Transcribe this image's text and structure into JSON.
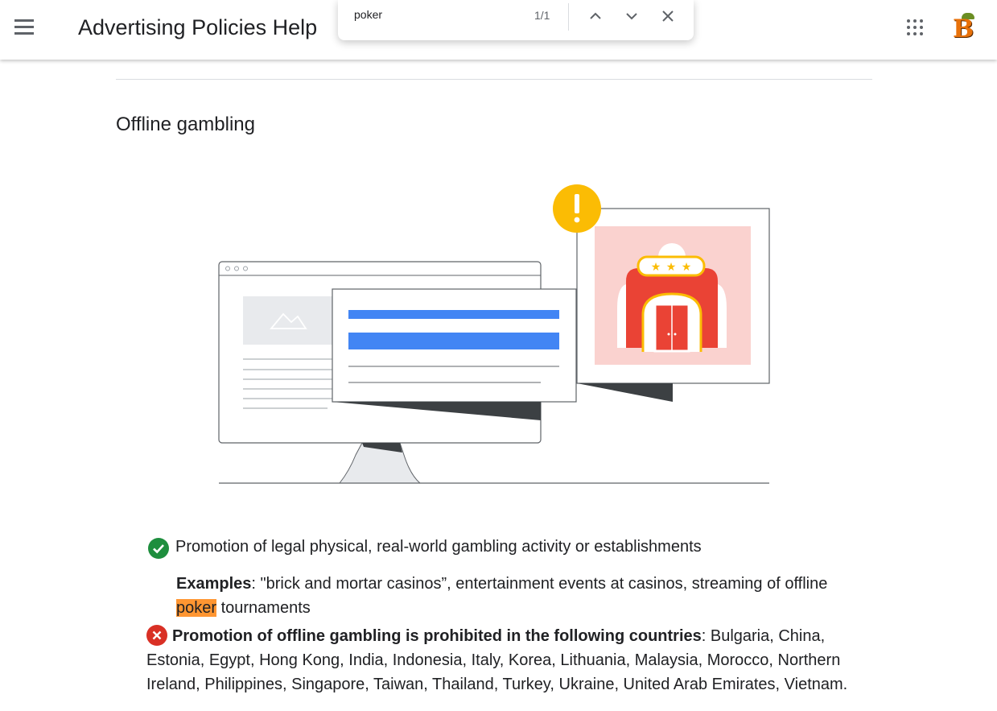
{
  "header": {
    "title": "Advertising Policies Help",
    "menu_icon": "hamburger-menu-icon",
    "apps_icon": "apps-grid-icon",
    "avatar_letter": "B"
  },
  "find_bar": {
    "query": "poker",
    "count": "1/1",
    "prev_icon": "chevron-up-icon",
    "next_icon": "chevron-down-icon",
    "close_icon": "close-icon"
  },
  "section": {
    "heading": "Offline gambling"
  },
  "allowed": {
    "icon": "check-circle-icon",
    "color": "#1e8e3e",
    "text": "Promotion of legal physical, real-world gambling activity or establishments",
    "examples_label": "Examples",
    "examples_text_before": ": \"brick and mortar casinos”, entertainment events at casinos, streaming of offline ",
    "examples_highlight": "poker",
    "examples_text_after": " tournaments"
  },
  "prohibited": {
    "icon": "x-circle-icon",
    "color": "#d93025",
    "label": "Promotion of offline gambling is prohibited in the following countries",
    "countries": ": Bulgaria, China, Estonia, Egypt, Hong Kong, India, Indonesia, Italy, Korea, Lithuania, Malaysia, Morocco, Northern Ireland, Philippines, Singapore, Taiwan, Thailand, Turkey, Ukraine, United Arab Emirates, Vietnam."
  },
  "colors": {
    "highlight": "#ff9632",
    "blue": "#4285f4",
    "red": "#ea4335",
    "yellow": "#fbbc04",
    "pink": "#fad2cf"
  }
}
